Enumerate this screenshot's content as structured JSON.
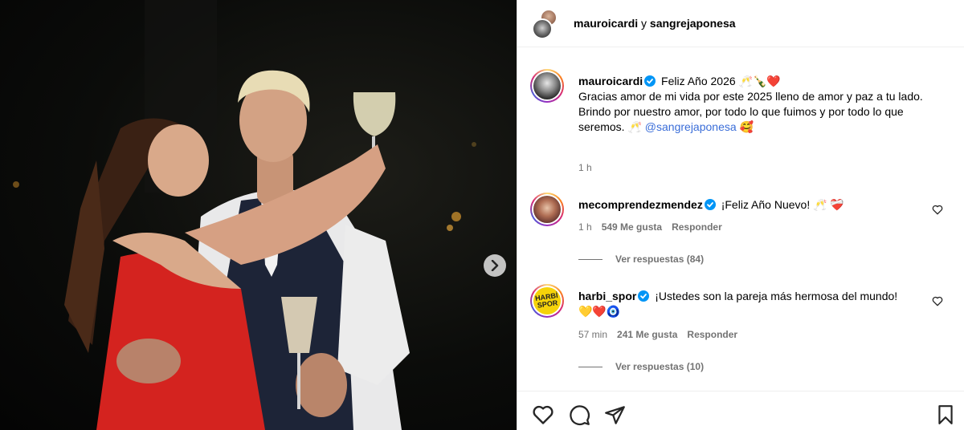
{
  "header": {
    "user1": "mauroicardi",
    "joiner": "y",
    "user2": "sangrejaponesa"
  },
  "caption": {
    "username": "mauroicardi",
    "line1": "Feliz Año 2026",
    "line1_emojis": "🥂🍾❤️",
    "line2": "Gracias amor de mi vida por este 2025 lleno de amor y paz a tu lado.",
    "line3": "Brindo por nuestro amor, por todo lo que fuimos y por todo lo que seremos.",
    "line3_emoji": "🥂",
    "mention": "@sangrejaponesa",
    "end_emoji": "🥰",
    "time": "1 h"
  },
  "comments": [
    {
      "username": "mecomprendezmendez",
      "text": "¡Feliz Año Nuevo!",
      "emojis": "🥂 ❤️‍🩹",
      "time": "1 h",
      "likes": "549 Me gusta",
      "reply": "Responder",
      "view_replies": "Ver respuestas (84)"
    },
    {
      "username": "harbi_spor",
      "avatar_text": "HARBİ SPOR",
      "text": "¡Ustedes son la pareja más hermosa del mundo!",
      "emojis": "💛❤️🧿",
      "time": "57 min",
      "likes": "241 Me gusta",
      "reply": "Responder",
      "view_replies": "Ver respuestas (10)"
    }
  ],
  "icons": {
    "verified": "verified-badge-icon",
    "like": "heart-icon",
    "comment": "comment-bubble-icon",
    "share": "paper-plane-icon",
    "save": "bookmark-icon",
    "next": "chevron-right-icon"
  },
  "colors": {
    "verified": "#0095f6",
    "mention": "#3a6dd8",
    "muted": "#737373"
  }
}
